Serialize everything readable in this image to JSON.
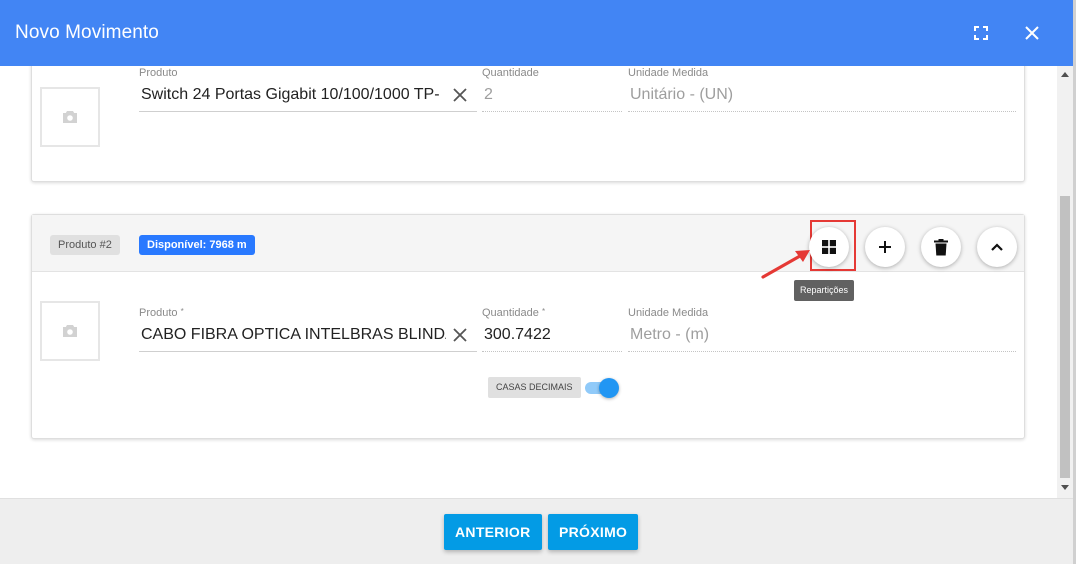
{
  "dialog": {
    "title": "Novo Movimento",
    "icons": {
      "fullscreen": "fullscreen-icon",
      "close": "close-icon"
    }
  },
  "product1": {
    "produto_label": "Produto",
    "produto_value": "Switch 24 Portas Gigabit 10/100/1000 TP-",
    "quantidade_label": "Quantidade",
    "quantidade_value": "2",
    "unidade_label": "Unidade Medida",
    "unidade_value": "Unitário - (UN)"
  },
  "product2": {
    "chip_label": "Produto #2",
    "disponivel": "Disponível: 7968 m",
    "produto_label": "Produto",
    "produto_value": "CABO FIBRA OPTICA INTELBRAS BLINDADO",
    "quantidade_label": "Quantidade",
    "quantidade_value": "300.7422",
    "unidade_label": "Unidade Medida",
    "unidade_value": "Metro - (m)",
    "casas_decimais": "CASAS DECIMAIS",
    "casas_decimais_on": true,
    "tooltip": "Repartições",
    "required_mark": "*"
  },
  "footer": {
    "prev_label": "ANTERIOR",
    "next_label": "PRÓXIMO"
  },
  "colors": {
    "header": "#4285f4",
    "accent": "#039be5",
    "chip_blue": "#2979ff",
    "highlight": "#e53935"
  }
}
